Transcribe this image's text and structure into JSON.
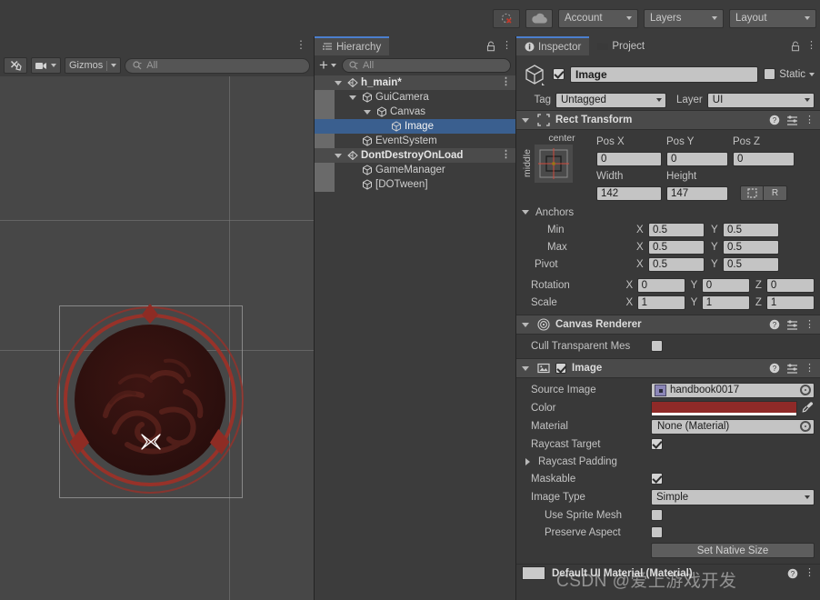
{
  "toolbar": {
    "cloud_icon": "cloud-icon",
    "collab_icon": "collab-error-icon",
    "account_label": "Account",
    "layers_label": "Layers",
    "layout_label": "Layout"
  },
  "scene_view": {
    "tools_icon": "tools-icon",
    "camera_icon": "camera-icon",
    "gizmos_label": "Gizmos",
    "search_placeholder": "All",
    "search_icon": "search-icon",
    "kebab_icon": "kebab-menu-icon",
    "gizmo_name": "move-tool-gizmo",
    "emblem_name": "handbook0017-sprite"
  },
  "hierarchy": {
    "tab_label": "Hierarchy",
    "tab_icon": "hierarchy-icon",
    "lock_icon": "lock-icon",
    "kebab_icon": "kebab-menu-icon",
    "add_label": "+",
    "search_placeholder": "All",
    "search_icon": "search-icon",
    "items": [
      {
        "label": "h_main*",
        "depth": 0,
        "type": "scene",
        "expanded": true,
        "selected": false,
        "kebab": true
      },
      {
        "label": "GuiCamera",
        "depth": 1,
        "type": "object",
        "expanded": true,
        "selected": false,
        "kebab": false
      },
      {
        "label": "Canvas",
        "depth": 2,
        "type": "object",
        "expanded": true,
        "selected": false,
        "kebab": false
      },
      {
        "label": "Image",
        "depth": 3,
        "type": "object",
        "expanded": false,
        "selected": true,
        "kebab": false
      },
      {
        "label": "EventSystem",
        "depth": 1,
        "type": "object",
        "expanded": false,
        "selected": false,
        "kebab": false
      },
      {
        "label": "DontDestroyOnLoad",
        "depth": 0,
        "type": "scene",
        "expanded": true,
        "selected": false,
        "kebab": true
      },
      {
        "label": "GameManager",
        "depth": 1,
        "type": "object",
        "expanded": false,
        "selected": false,
        "kebab": false
      },
      {
        "label": "[DOTween]",
        "depth": 1,
        "type": "object",
        "expanded": false,
        "selected": false,
        "kebab": false
      }
    ]
  },
  "inspector": {
    "tabs": [
      {
        "label": "Inspector",
        "icon": "info-icon",
        "active": true
      },
      {
        "label": "Project",
        "icon": "folder-icon",
        "active": false
      }
    ],
    "lock_icon": "lock-icon",
    "kebab_icon": "kebab-menu-icon",
    "object_icon": "gameobject-cube-icon",
    "enabled_checked": true,
    "object_name": "Image",
    "static_label": "Static",
    "static_checked": false,
    "tag_label": "Tag",
    "tag_value": "Untagged",
    "layer_label": "Layer",
    "layer_value": "UI",
    "rect_transform": {
      "title": "Rect Transform",
      "icon": "rect-transform-icon",
      "help_icon": "help-icon",
      "preset_icon": "preset-icon",
      "kebab_icon": "kebab-menu-icon",
      "anchor_preset_top": "center",
      "anchor_preset_side": "middle",
      "pos_x_label": "Pos X",
      "pos_x": "0",
      "pos_y_label": "Pos Y",
      "pos_y": "0",
      "pos_z_label": "Pos Z",
      "pos_z": "0",
      "width_label": "Width",
      "width": "142",
      "height_label": "Height",
      "height": "147",
      "blueprint_icon": "blueprint-mode-icon",
      "raw_label": "R",
      "anchors_label": "Anchors",
      "min_label": "Min",
      "min_x": "0.5",
      "min_y": "0.5",
      "max_label": "Max",
      "max_x": "0.5",
      "max_y": "0.5",
      "pivot_label": "Pivot",
      "pivot_x": "0.5",
      "pivot_y": "0.5",
      "rotation_label": "Rotation",
      "rot_x": "0",
      "rot_y": "0",
      "rot_z": "0",
      "scale_label": "Scale",
      "scale_x": "1",
      "scale_y": "1",
      "scale_z": "1",
      "x_axis": "X",
      "y_axis": "Y",
      "z_axis": "Z"
    },
    "canvas_renderer": {
      "title": "Canvas Renderer",
      "icon": "canvas-renderer-icon",
      "help_icon": "help-icon",
      "preset_icon": "preset-icon",
      "kebab_icon": "kebab-menu-icon",
      "cull_label": "Cull Transparent Mes",
      "cull_checked": false
    },
    "image": {
      "title": "Image",
      "icon": "image-component-icon",
      "enabled_checked": true,
      "help_icon": "help-icon",
      "preset_icon": "preset-icon",
      "kebab_icon": "kebab-menu-icon",
      "source_image_label": "Source Image",
      "source_image_value": "handbook0017",
      "source_image_icon": "sprite-icon",
      "color_label": "Color",
      "color_value": "#8F2A28",
      "color_alpha": "#FFFFFF",
      "eyedropper_icon": "eyedropper-icon",
      "material_label": "Material",
      "material_value": "None (Material)",
      "raycast_target_label": "Raycast Target",
      "raycast_target_checked": true,
      "raycast_padding_label": "Raycast Padding",
      "maskable_label": "Maskable",
      "maskable_checked": true,
      "image_type_label": "Image Type",
      "image_type_value": "Simple",
      "use_sprite_mesh_label": "Use Sprite Mesh",
      "use_sprite_mesh_checked": false,
      "preserve_aspect_label": "Preserve Aspect",
      "preserve_aspect_checked": false,
      "set_native_size_label": "Set Native Size"
    },
    "material_footer": {
      "label": "Default UI Material (Material)",
      "help_icon": "help-icon",
      "kebab_icon": "kebab-menu-icon"
    }
  },
  "watermark": {
    "text": "CSDN @爱上游戏开发"
  },
  "colors": {
    "accent_blue": "#3A5F8F",
    "tab_accent": "#4B7FCE",
    "image_color": "#8F2A28",
    "panel_bg": "#393939",
    "scene_bg": "#474747"
  }
}
